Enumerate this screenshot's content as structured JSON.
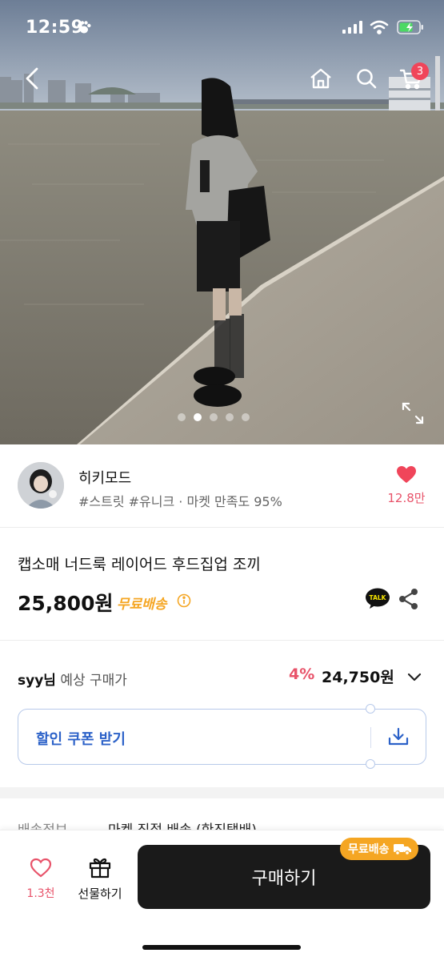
{
  "status_bar": {
    "time": "12:59"
  },
  "header": {
    "cart_count": "3"
  },
  "gallery": {
    "total_images": 5,
    "active_index": 1
  },
  "seller": {
    "name": "히키모드",
    "meta": "#스트릿 #유니크 · 마켓 만족도 95%",
    "likes": "12.8만"
  },
  "product": {
    "title": "캡소매 너드룩 레이어드 후드집업 조끼",
    "price": "25,800원",
    "free_shipping": "무료배송"
  },
  "expected_price": {
    "user": "syy님",
    "label": "예상 구매가",
    "discount_rate": "4%",
    "price": "24,750원"
  },
  "coupon": {
    "label": "할인 쿠폰 받기"
  },
  "shipping": {
    "label": "배송정보",
    "value": "마켓 직접 배송 (한진택배)"
  },
  "bottom_bar": {
    "likes": "1.3천",
    "gift_label": "선물하기",
    "buy_label": "구매하기",
    "badge": "무료배송"
  },
  "colors": {
    "accent_pink": "#e8536a",
    "free_ship_orange": "#f5a623",
    "coupon_blue": "#2b61c8",
    "buy_button": "#1a1a1a"
  }
}
